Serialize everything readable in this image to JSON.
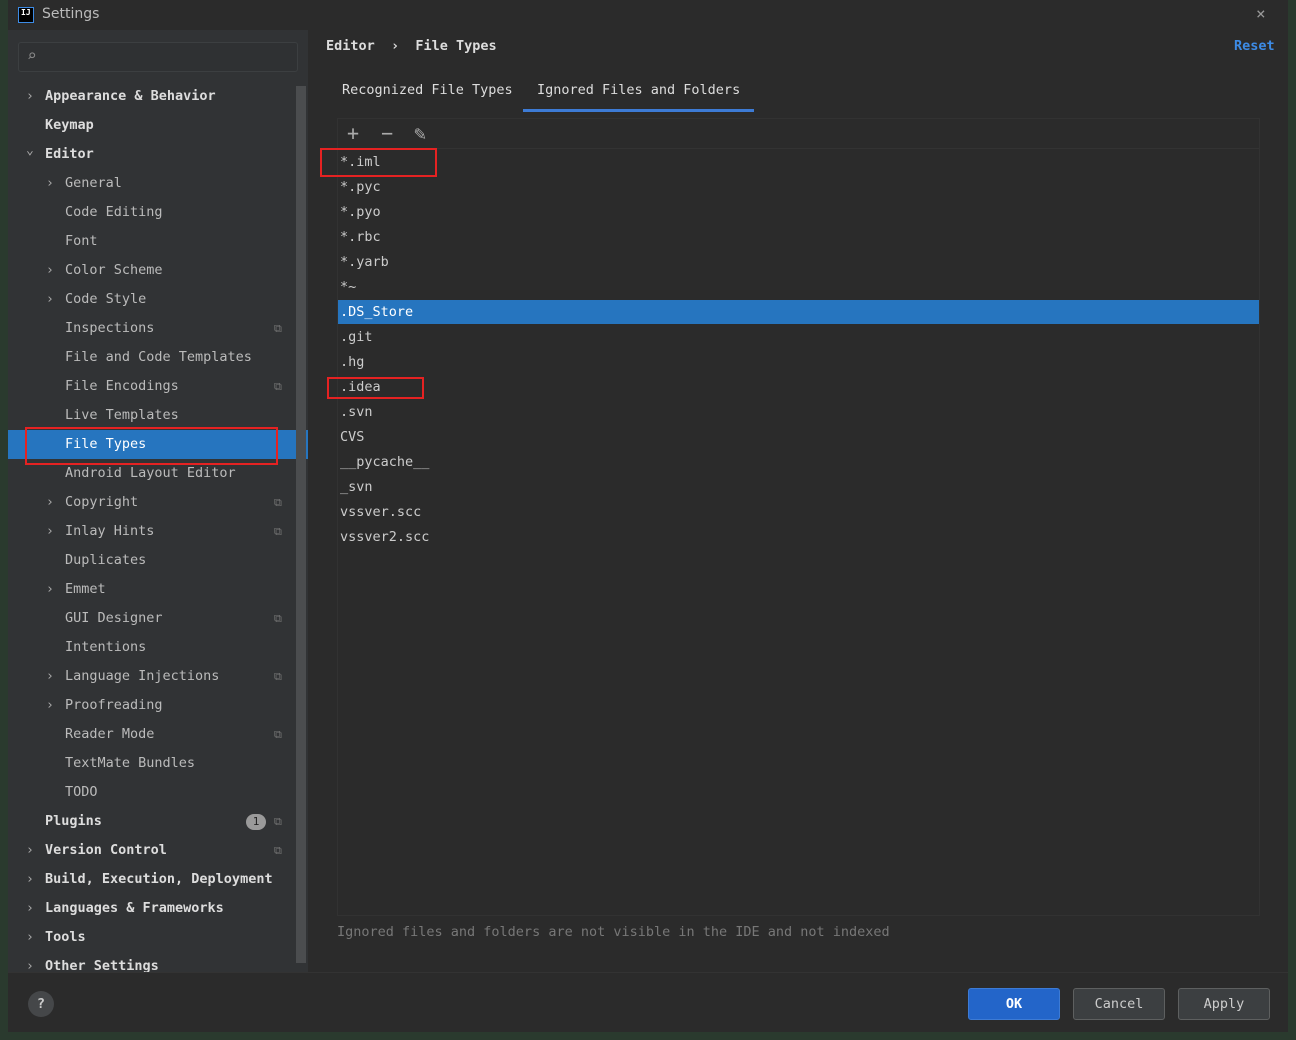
{
  "window": {
    "title": "Settings",
    "close_icon": "×"
  },
  "sidebar": {
    "search_placeholder": "",
    "items": [
      {
        "label": "Appearance & Behavior",
        "level": 0,
        "chevron": "right",
        "bold": true
      },
      {
        "label": "Keymap",
        "level": 0,
        "bold": true
      },
      {
        "label": "Editor",
        "level": 0,
        "chevron": "down",
        "bold": true
      },
      {
        "label": "General",
        "level": 1,
        "chevron": "right"
      },
      {
        "label": "Code Editing",
        "level": 1
      },
      {
        "label": "Font",
        "level": 1
      },
      {
        "label": "Color Scheme",
        "level": 1,
        "chevron": "right"
      },
      {
        "label": "Code Style",
        "level": 1,
        "chevron": "right"
      },
      {
        "label": "Inspections",
        "level": 1,
        "cfg": true
      },
      {
        "label": "File and Code Templates",
        "level": 1
      },
      {
        "label": "File Encodings",
        "level": 1,
        "cfg": true
      },
      {
        "label": "Live Templates",
        "level": 1
      },
      {
        "label": "File Types",
        "level": 1,
        "selected": true
      },
      {
        "label": "Android Layout Editor",
        "level": 1
      },
      {
        "label": "Copyright",
        "level": 1,
        "chevron": "right",
        "cfg": true
      },
      {
        "label": "Inlay Hints",
        "level": 1,
        "chevron": "right",
        "cfg": true
      },
      {
        "label": "Duplicates",
        "level": 1
      },
      {
        "label": "Emmet",
        "level": 1,
        "chevron": "right"
      },
      {
        "label": "GUI Designer",
        "level": 1,
        "cfg": true
      },
      {
        "label": "Intentions",
        "level": 1
      },
      {
        "label": "Language Injections",
        "level": 1,
        "chevron": "right",
        "cfg": true
      },
      {
        "label": "Proofreading",
        "level": 1,
        "chevron": "right"
      },
      {
        "label": "Reader Mode",
        "level": 1,
        "cfg": true
      },
      {
        "label": "TextMate Bundles",
        "level": 1
      },
      {
        "label": "TODO",
        "level": 1
      },
      {
        "label": "Plugins",
        "level": 0,
        "bold": true,
        "badge": "1",
        "cfg": true
      },
      {
        "label": "Version Control",
        "level": 0,
        "chevron": "right",
        "bold": true,
        "cfg": true
      },
      {
        "label": "Build, Execution, Deployment",
        "level": 0,
        "chevron": "right",
        "bold": true
      },
      {
        "label": "Languages & Frameworks",
        "level": 0,
        "chevron": "right",
        "bold": true
      },
      {
        "label": "Tools",
        "level": 0,
        "chevron": "right",
        "bold": true
      },
      {
        "label": "Other Settings",
        "level": 0,
        "chevron": "right",
        "bold": true
      }
    ]
  },
  "main": {
    "breadcrumb": "Editor  ›  File Types",
    "reset": "Reset",
    "tabs": [
      {
        "label": "Recognized File Types"
      },
      {
        "label": "Ignored Files and Folders",
        "active": true
      }
    ],
    "toolbar": {
      "add": "+",
      "remove": "−",
      "edit": "✎"
    },
    "items": [
      "*.iml",
      "*.pyc",
      "*.pyo",
      "*.rbc",
      "*.yarb",
      "*~",
      ".DS_Store",
      ".git",
      ".hg",
      ".idea",
      ".svn",
      "CVS",
      "__pycache__",
      "_svn",
      "vssver.scc",
      "vssver2.scc"
    ],
    "selected_item": ".DS_Store",
    "hint": "Ignored files and folders are not visible in the IDE and not indexed"
  },
  "footer": {
    "help": "?",
    "ok": "OK",
    "cancel": "Cancel",
    "apply": "Apply"
  },
  "colors": {
    "accent": "#2675bf",
    "highlight_box": "#e52222",
    "link": "#3d8be5"
  }
}
